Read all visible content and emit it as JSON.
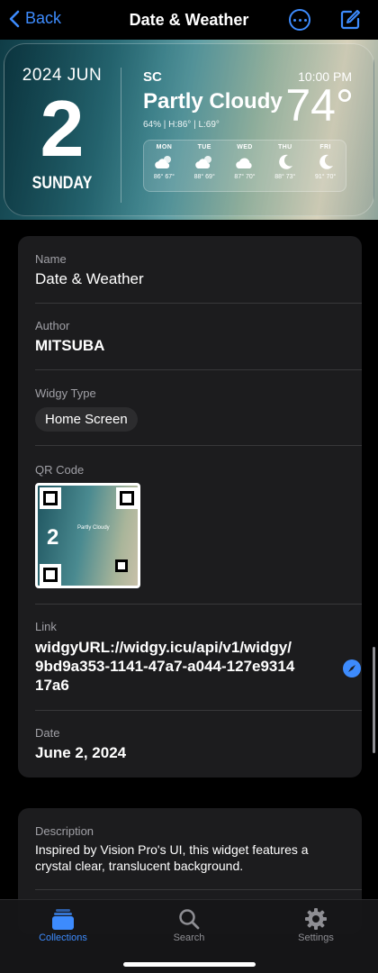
{
  "nav": {
    "back_label": "Back",
    "title": "Date & Weather"
  },
  "widget": {
    "year_month": "2024 JUN",
    "day": "2",
    "weekday": "SUNDAY",
    "city": "SC",
    "time": "10:00 PM",
    "condition": "Partly Cloudy",
    "temperature": "74°",
    "stats": "64% | H:86° | L:69°",
    "forecast": [
      {
        "day": "MON",
        "icon": "partly-cloudy-icon",
        "hl": "86° 67°"
      },
      {
        "day": "TUE",
        "icon": "partly-cloudy-icon",
        "hl": "88° 69°"
      },
      {
        "day": "WED",
        "icon": "cloud-icon",
        "hl": "87° 70°"
      },
      {
        "day": "THU",
        "icon": "moon-icon",
        "hl": "88° 73°"
      },
      {
        "day": "FRI",
        "icon": "moon-icon",
        "hl": "91° 70°"
      }
    ]
  },
  "details": {
    "name_label": "Name",
    "name_value": "Date & Weather",
    "author_label": "Author",
    "author_value": "MITSUBA",
    "type_label": "Widgy Type",
    "type_value": "Home Screen",
    "qr_label": "QR Code",
    "qr_inner_text": "Partly Cloudy",
    "link_label": "Link",
    "link_value": "widgyURL://widgy.icu/api/v1/widgy/9bd9a353-1141-47a7-a044-127e931417a6",
    "date_label": "Date",
    "date_value": "June 2, 2024"
  },
  "description": {
    "label": "Description",
    "text": "Inspired by Vision Pro's UI, this widget features a crystal clear, translucent background."
  },
  "tabs": [
    {
      "label": "Collections",
      "icon": "stack-icon",
      "active": true
    },
    {
      "label": "Search",
      "icon": "search-icon",
      "active": false
    },
    {
      "label": "Settings",
      "icon": "gear-icon",
      "active": false
    }
  ],
  "colors": {
    "accent": "#3d8bfd",
    "card_bg": "#1c1c1e",
    "background": "#000000"
  }
}
